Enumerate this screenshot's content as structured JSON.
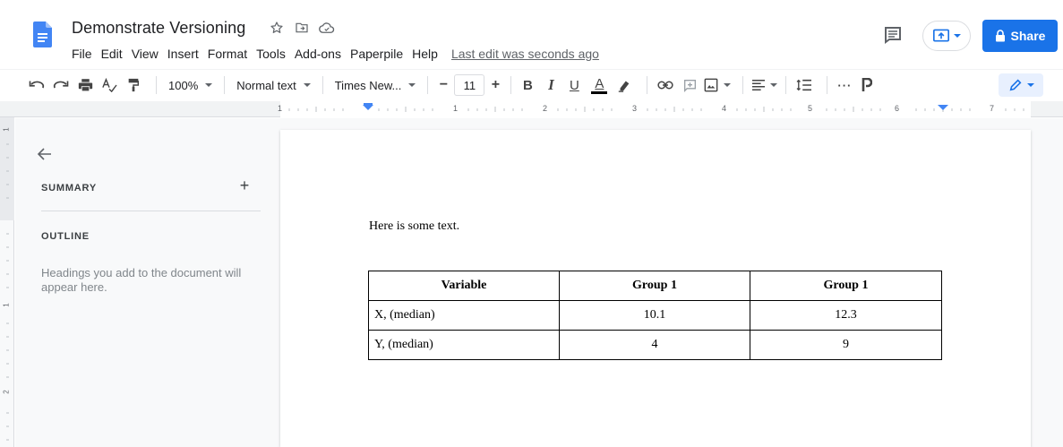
{
  "header": {
    "title": "Demonstrate Versioning",
    "menu": [
      "File",
      "Edit",
      "View",
      "Insert",
      "Format",
      "Tools",
      "Add-ons",
      "Paperpile",
      "Help"
    ],
    "last_edit": "Last edit was seconds ago",
    "share_label": "Share",
    "icons": [
      "docs-logo-icon",
      "star-icon",
      "move-to-folder-icon",
      "cloud-saved-icon",
      "comments-icon",
      "present-icon",
      "lock-icon"
    ]
  },
  "toolbar": {
    "zoom": "100%",
    "style": "Normal text",
    "font": "Times New...",
    "font_size": "11",
    "minus": "−",
    "plus": "+",
    "bold": "B",
    "italic": "I",
    "underline": "U",
    "text_color": "A",
    "more": "···",
    "icons": [
      "undo-icon",
      "redo-icon",
      "print-icon",
      "spellcheck-icon",
      "paint-format-icon",
      "highlight-icon",
      "link-icon",
      "comment-add-icon",
      "image-icon",
      "align-icon",
      "line-spacing-icon",
      "paperpile-icon",
      "edit-mode-icon"
    ]
  },
  "ruler": {
    "numbers": [
      "1",
      "1",
      "2",
      "3",
      "4",
      "5",
      "6",
      "7"
    ],
    "vnumbers": [
      "1",
      "1",
      "2"
    ]
  },
  "sidebar": {
    "summary": "SUMMARY",
    "add": "+",
    "outline": "OUTLINE",
    "hint": "Headings you add to the document will appear here."
  },
  "document": {
    "text": "Here is some text.",
    "table": {
      "headers": [
        "Variable",
        "Group 1",
        "Group 1"
      ],
      "rows": [
        [
          "X, (median)",
          "10.1",
          "12.3"
        ],
        [
          "Y, (median)",
          "4",
          "9"
        ]
      ]
    }
  },
  "colors": {
    "accent": "#1a73e8",
    "docs_blue": "#4285f4",
    "text": "#202124"
  }
}
